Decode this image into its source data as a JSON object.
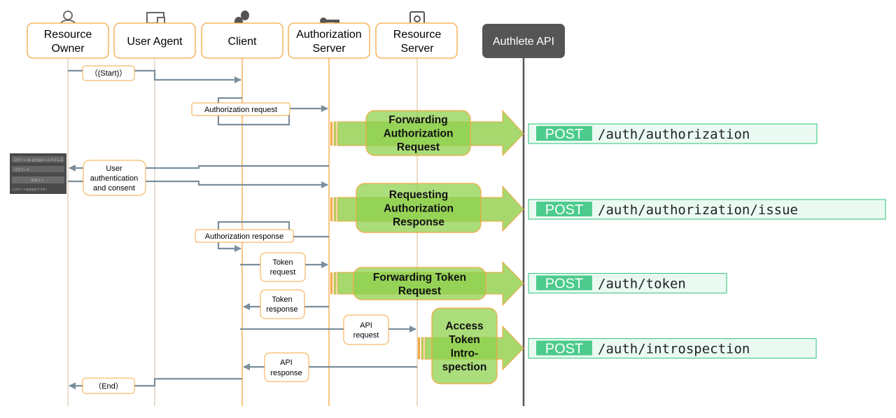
{
  "participants": [
    {
      "line1": "Resource",
      "line2": "Owner",
      "icon": "person-icon"
    },
    {
      "line1": "User Agent",
      "icon": "devices-icon"
    },
    {
      "line1": "Client",
      "icon": "theater-masks-icon"
    },
    {
      "line1": "Authorization",
      "line2": "Server",
      "icon": "key-icon"
    },
    {
      "line1": "Resource",
      "line2": "Server",
      "icon": "safe-icon"
    },
    {
      "line1": "Authlete API"
    }
  ],
  "messages": {
    "start": "（(Start)）",
    "authz_request": "Authorization request",
    "user_auth": [
      "User",
      "authentication",
      "and consent"
    ],
    "authz_response": "Authorization response",
    "token_request": [
      "Token",
      "request"
    ],
    "token_response": [
      "Token",
      "response"
    ],
    "api_request": [
      "API",
      "request"
    ],
    "api_response": [
      "API",
      "response"
    ],
    "end": "（End）"
  },
  "steps": [
    {
      "lines": [
        "Forwarding",
        "Authorization",
        "Request"
      ],
      "method": "POST",
      "path": "/auth/authorization"
    },
    {
      "lines": [
        "Requesting",
        "Authorization",
        "Response"
      ],
      "method": "POST",
      "path": "/auth/authorization/issue"
    },
    {
      "lines": [
        "Forwarding Token",
        "Request"
      ],
      "method": "POST",
      "path": "/auth/token"
    },
    {
      "lines": [
        "Access",
        "Token",
        "Intro-",
        "spection"
      ],
      "method": "POST",
      "path": "/auth/introspection"
    }
  ],
  "login_form": {
    "id_field": "ログイン ID またはメールアドレス",
    "password_field": "パスワード",
    "login_button": "ログイン",
    "forgot": "パスワードをお忘れですか?"
  },
  "colors": {
    "orange": "#f5a742",
    "arrow": "#7a8e9c",
    "green": "#8fd14f",
    "post_green": "#4ccb8c",
    "authlete": "#555555"
  }
}
